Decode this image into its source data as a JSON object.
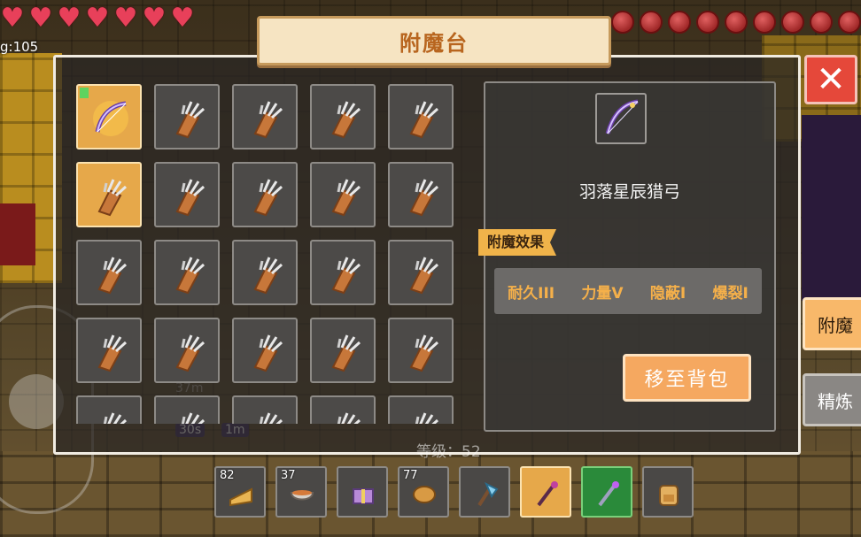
{
  "hud": {
    "hearts": 7,
    "food": 9,
    "coord_text": "g:105"
  },
  "title": "附魔台",
  "close_label": "✕",
  "inventory": {
    "selected_index": 5,
    "slots": [
      {
        "item": "bow-icon",
        "badge": true
      },
      {
        "item": "quiver-icon"
      },
      {
        "item": "quiver-icon"
      },
      {
        "item": "quiver-icon"
      },
      {
        "item": "quiver-icon"
      },
      {
        "item": "quiver-icon"
      },
      {
        "item": "quiver-icon"
      },
      {
        "item": "quiver-icon"
      },
      {
        "item": "quiver-icon"
      },
      {
        "item": "quiver-icon"
      },
      {
        "item": "quiver-icon"
      },
      {
        "item": "quiver-icon"
      },
      {
        "item": "quiver-icon"
      },
      {
        "item": "quiver-icon"
      },
      {
        "item": "quiver-icon"
      },
      {
        "item": "quiver-icon"
      },
      {
        "item": "quiver-icon"
      },
      {
        "item": "quiver-icon"
      },
      {
        "item": "quiver-icon"
      },
      {
        "item": "quiver-icon"
      },
      {
        "item": "quiver-icon"
      },
      {
        "item": "quiver-icon"
      },
      {
        "item": "quiver-icon"
      },
      {
        "item": "quiver-icon"
      },
      {
        "item": "quiver-icon"
      }
    ]
  },
  "detail": {
    "item_name": "羽落星辰猎弓",
    "effects_tag": "附魔效果",
    "enchantments": [
      "耐久III",
      "力量V",
      "隐蔽I",
      "爆裂I"
    ],
    "move_button": "移至背包"
  },
  "side_tabs": {
    "enchant": "附魔",
    "refine": "精炼"
  },
  "background": {
    "level_text": "等级：52",
    "timer_1": "30s",
    "timer_2": "1m",
    "distance": "37m"
  },
  "hotbar": [
    {
      "count": "82",
      "icon": "cheese-icon"
    },
    {
      "count": "37",
      "icon": "soup-bowl-icon"
    },
    {
      "count": "",
      "icon": "gift-box-icon"
    },
    {
      "count": "77",
      "icon": "bread-icon"
    },
    {
      "count": "",
      "icon": "axe-icon"
    },
    {
      "count": "",
      "icon": "staff-icon",
      "selected": true
    },
    {
      "count": "",
      "icon": "magic-wand-icon",
      "green": true
    },
    {
      "count": "",
      "icon": "backpack-icon"
    }
  ],
  "colors": {
    "accent": "#f5a860",
    "enchant_text": "#f5b04a",
    "close": "#e5483a",
    "title_text": "#b8651e"
  }
}
